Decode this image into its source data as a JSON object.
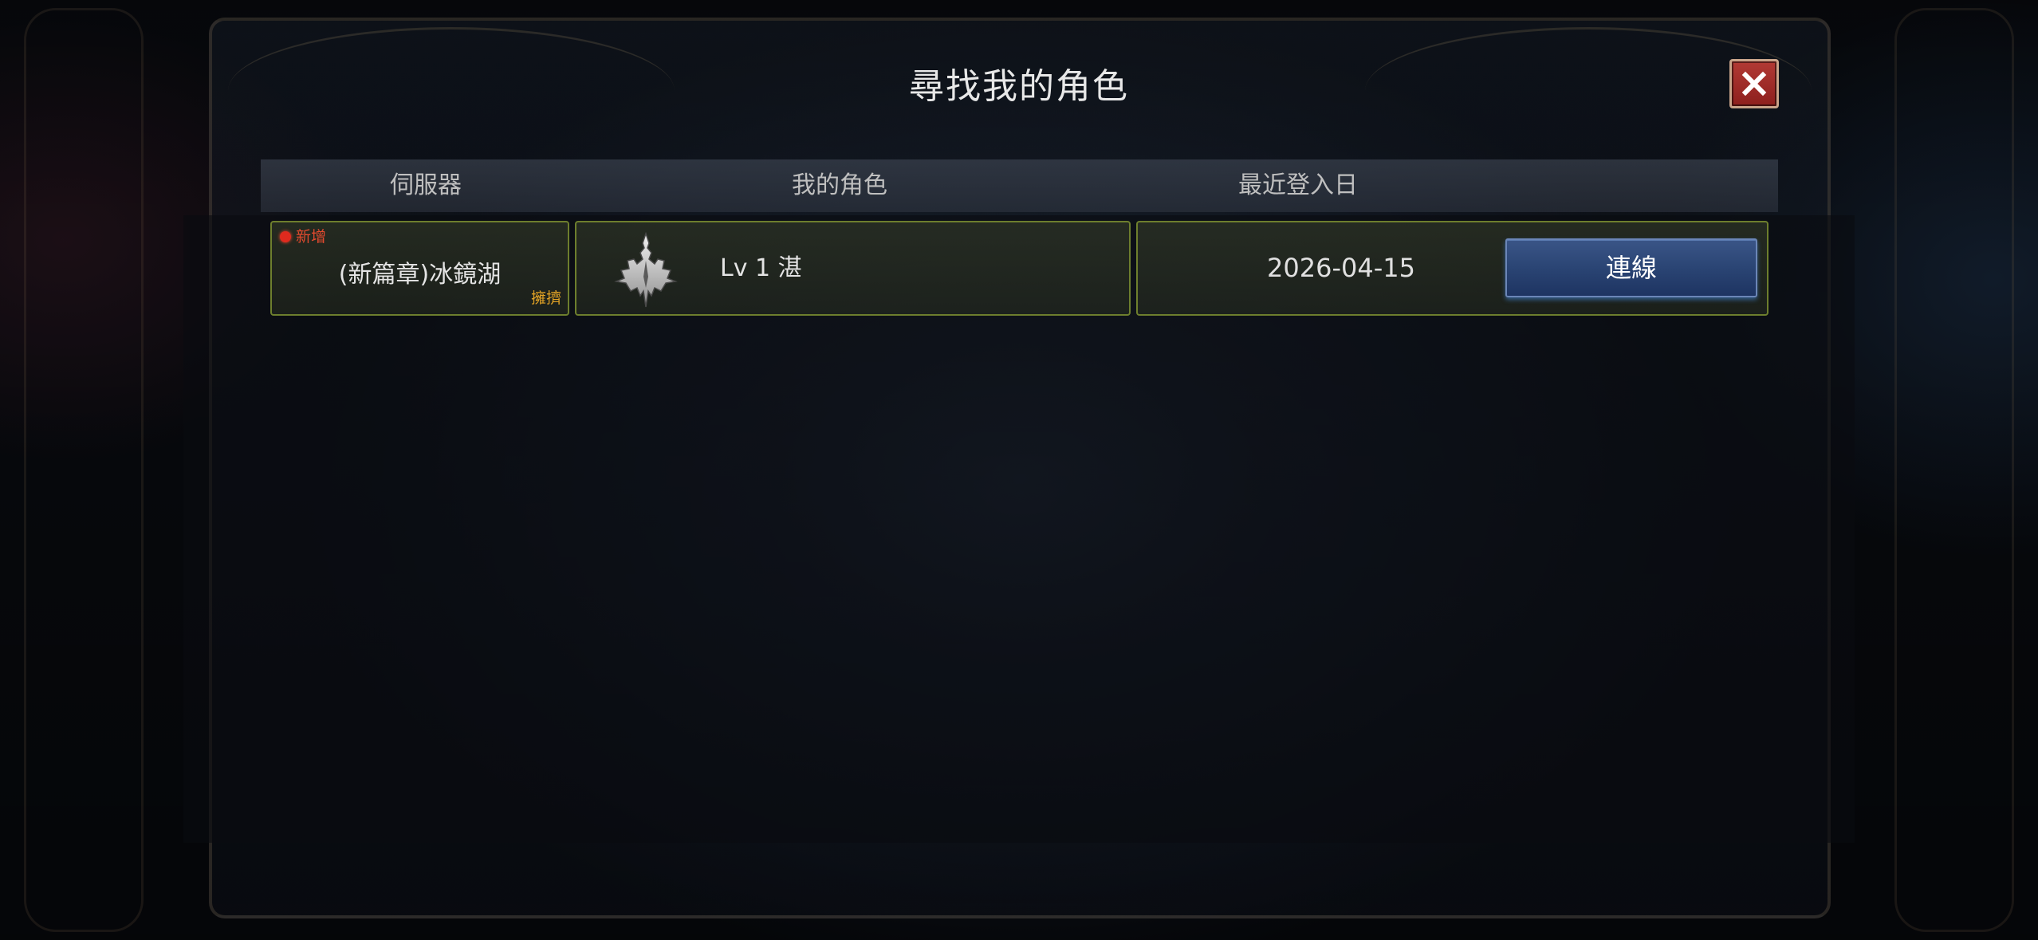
{
  "dialog": {
    "title": "尋找我的角色",
    "close_icon": "close-icon"
  },
  "table": {
    "columns": [
      "伺服器",
      "我的角色",
      "最近登入日"
    ],
    "rows": [
      {
        "badge": "新增",
        "server": "(新篇章)冰鏡湖",
        "status": "擁擠",
        "class_icon": "class-emblem-icon",
        "character": "Lv 1 湛",
        "last_login": "2026-04-15",
        "action": "連線"
      }
    ]
  },
  "colors": {
    "row_border": "#6d7e2d",
    "new_badge": "#e24a2e",
    "status_busy": "#e3a325",
    "connect_button": "#294372",
    "close_button": "#8d1f1d"
  }
}
